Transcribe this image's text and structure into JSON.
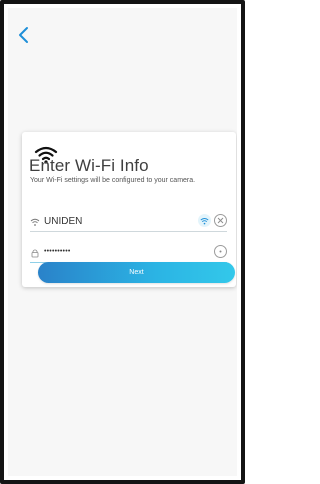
{
  "colors": {
    "accent": "#1e8fd8",
    "button_gradient_start": "#2a82c9",
    "button_gradient_end": "#33c8ea",
    "background": "#f7f7f7",
    "card": "#ffffff"
  },
  "nav": {
    "back_icon": "chevron-left-icon"
  },
  "card": {
    "icon": "wifi-icon",
    "title": "Enter Wi-Fi Info",
    "subtitle": "Your Wi-Fi settings will be configured to your camera."
  },
  "ssid_field": {
    "lead_icon": "wifi-icon",
    "value": "UNIDEN",
    "status_icon": "wifi-connected-icon",
    "clear_icon": "clear-icon"
  },
  "password_field": {
    "lead_icon": "lock-icon",
    "value": "••••••••••",
    "reveal_icon": "eye-icon"
  },
  "next_button": {
    "label": "Next"
  }
}
